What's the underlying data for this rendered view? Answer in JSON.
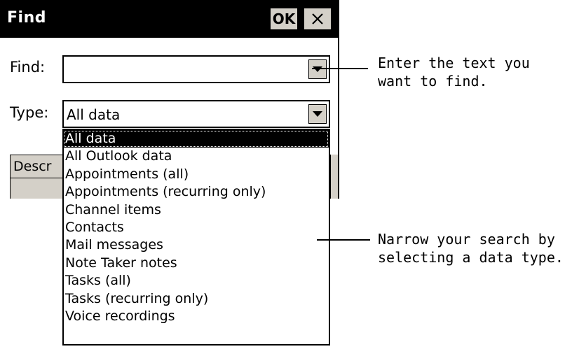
{
  "dialog": {
    "title": "Find",
    "ok_label": "OK",
    "close_icon": "close-icon"
  },
  "find_field": {
    "label": "Find:",
    "value": "",
    "arrow_icon": "chevron-down-icon"
  },
  "type_field": {
    "label": "Type:",
    "value": "All data",
    "arrow_icon": "chevron-down-icon"
  },
  "hidden_tab": {
    "label": "Descr"
  },
  "type_options": [
    {
      "label": "All data",
      "selected": true
    },
    {
      "label": "All Outlook data",
      "selected": false
    },
    {
      "label": "Appointments (all)",
      "selected": false
    },
    {
      "label": "Appointments (recurring only)",
      "selected": false
    },
    {
      "label": "Channel items",
      "selected": false
    },
    {
      "label": "Contacts",
      "selected": false
    },
    {
      "label": "Mail messages",
      "selected": false
    },
    {
      "label": "Note Taker notes",
      "selected": false
    },
    {
      "label": "Tasks (all)",
      "selected": false
    },
    {
      "label": "Tasks (recurring only)",
      "selected": false
    },
    {
      "label": "Voice recordings",
      "selected": false
    }
  ],
  "callouts": {
    "find": {
      "line1": "Enter the text you",
      "line2": "want to find."
    },
    "type": {
      "line1": "Narrow your search by",
      "line2": "selecting a data type."
    }
  },
  "colors": {
    "titlebar": "#000000",
    "button_face": "#d4d0c8",
    "selection": "#000000",
    "background": "#ffffff"
  }
}
